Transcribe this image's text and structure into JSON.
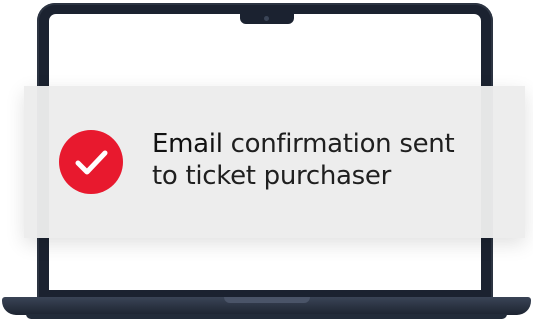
{
  "notification": {
    "message_bold": "Email",
    "message_rest": " confirmation sent",
    "message_line2": "to ticket purchaser",
    "icon": "check-circle-icon"
  },
  "colors": {
    "badge": "#e8192e",
    "laptop": "#1b2230",
    "card": "#ececec"
  }
}
